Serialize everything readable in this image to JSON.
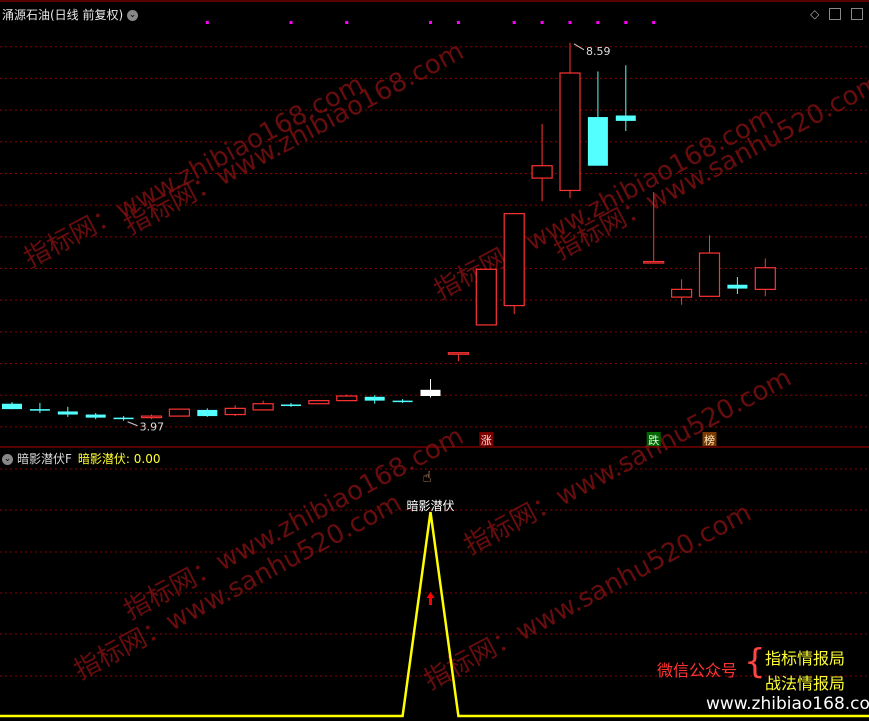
{
  "header": {
    "stock_title": "涌源石油(日线 前复权)",
    "indicator_name": "暗影潜伏F",
    "indicator_label": "暗影潜伏:",
    "indicator_value": "0.00"
  },
  "colors": {
    "up": "#ff3333",
    "down": "#54ffff",
    "grid": "#8b0000",
    "indicator_line": "#ffff00",
    "signal_arrow": "#ff0000",
    "markers": "#ff00ff"
  },
  "watermarks": [
    "指标网：www.zhibiao168.com",
    "指标网：www.sanhu520.com"
  ],
  "promo": {
    "wechat": "微信公众号",
    "line1": "指标情报局",
    "line2": "战法情报局",
    "site": "www.zhibiao168.com"
  },
  "chart_data": [
    {
      "type": "candlestick",
      "title": "涌源石油(日线 前复权)",
      "ohlc": [
        {
          "o": 3.92,
          "h": 3.94,
          "l": 3.85,
          "c": 3.85
        },
        {
          "o": 3.85,
          "h": 3.93,
          "l": 3.8,
          "c": 3.83
        },
        {
          "o": 3.82,
          "h": 3.88,
          "l": 3.75,
          "c": 3.78
        },
        {
          "o": 3.78,
          "h": 3.8,
          "l": 3.72,
          "c": 3.74
        },
        {
          "o": 3.74,
          "h": 3.76,
          "l": 3.7,
          "c": 3.72
        },
        {
          "o": 3.74,
          "h": 3.78,
          "l": 3.72,
          "c": 3.76
        },
        {
          "o": 3.76,
          "h": 3.85,
          "l": 3.76,
          "c": 3.85
        },
        {
          "o": 3.84,
          "h": 3.86,
          "l": 3.75,
          "c": 3.76
        },
        {
          "o": 3.78,
          "h": 3.9,
          "l": 3.76,
          "c": 3.86
        },
        {
          "o": 3.84,
          "h": 3.96,
          "l": 3.84,
          "c": 3.92
        },
        {
          "o": 3.91,
          "h": 3.93,
          "l": 3.88,
          "c": 3.89
        },
        {
          "o": 3.92,
          "h": 3.97,
          "l": 3.92,
          "c": 3.96
        },
        {
          "o": 3.96,
          "h": 4.04,
          "l": 3.96,
          "c": 4.02
        },
        {
          "o": 4.01,
          "h": 4.03,
          "l": 3.92,
          "c": 3.96
        },
        {
          "o": 3.96,
          "h": 3.98,
          "l": 3.93,
          "c": 3.95
        },
        {
          "o": 4.1,
          "h": 4.24,
          "l": 4.0,
          "c": 4.02
        },
        {
          "o": 4.58,
          "h": 4.58,
          "l": 4.47,
          "c": 4.58
        },
        {
          "o": 4.94,
          "h": 5.66,
          "l": 4.94,
          "c": 5.66
        },
        {
          "o": 5.19,
          "h": 6.38,
          "l": 5.08,
          "c": 6.38
        },
        {
          "o": 6.84,
          "h": 7.54,
          "l": 6.54,
          "c": 7.0
        },
        {
          "o": 6.68,
          "h": 8.59,
          "l": 6.58,
          "c": 8.2
        },
        {
          "o": 7.63,
          "h": 8.22,
          "l": 7.2,
          "c": 7.0
        },
        {
          "o": 7.65,
          "h": 8.3,
          "l": 7.45,
          "c": 7.58
        },
        {
          "o": 5.76,
          "h": 6.66,
          "l": 5.76,
          "c": 5.76
        },
        {
          "o": 5.3,
          "h": 5.53,
          "l": 5.2,
          "c": 5.4
        },
        {
          "o": 5.31,
          "h": 6.1,
          "l": 5.31,
          "c": 5.87
        },
        {
          "o": 5.46,
          "h": 5.56,
          "l": 5.34,
          "c": 5.41
        },
        {
          "o": 5.4,
          "h": 5.8,
          "l": 5.31,
          "c": 5.68
        }
      ],
      "high_label": "8.59",
      "low_label": "3.97",
      "signals": [
        {
          "index": 17,
          "text": "涨"
        },
        {
          "index": 23,
          "text": "跌"
        },
        {
          "index": 25,
          "text": "榜"
        }
      ],
      "top_markers": [
        7,
        10,
        12,
        15,
        16,
        18,
        19,
        20,
        21,
        22,
        23
      ],
      "ylim": [
        3.58,
        8.86
      ],
      "gridlines": [
        8.54,
        8.13,
        7.72,
        7.31,
        6.9,
        6.49,
        6.08,
        5.67,
        5.26,
        4.85,
        4.44,
        4.03,
        3.62
      ]
    },
    {
      "type": "line",
      "title": "暗影潜伏F",
      "series": [
        {
          "name": "暗影潜伏",
          "values": [
            0,
            0,
            0,
            0,
            0,
            0,
            0,
            0,
            0,
            0,
            0,
            0,
            0,
            0,
            0,
            1,
            0,
            0,
            0,
            0,
            0,
            0,
            0,
            0,
            0,
            0,
            0,
            0
          ]
        }
      ],
      "peak_label": "暗影潜伏",
      "ylim": [
        0,
        1
      ]
    }
  ]
}
